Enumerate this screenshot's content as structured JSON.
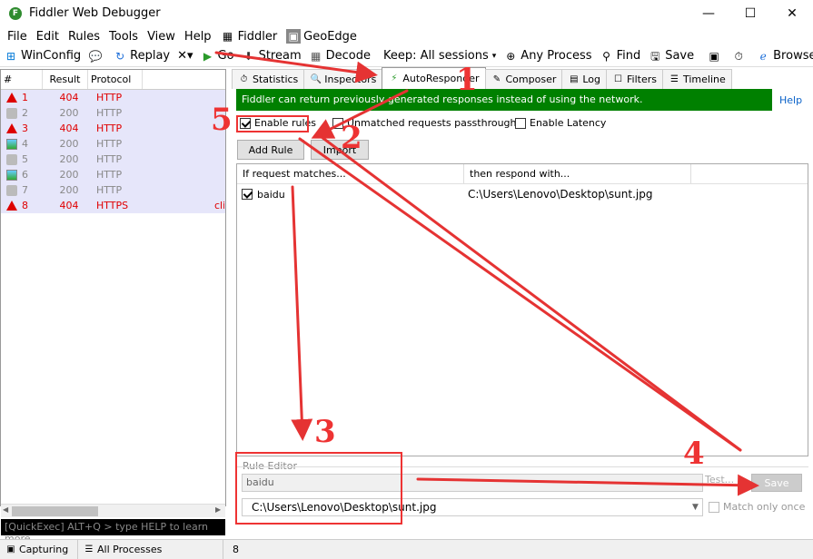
{
  "window": {
    "title": "Fiddler Web Debugger",
    "icon_letter": "F",
    "minimize_glyph": "—",
    "maximize_glyph": "☐",
    "close_glyph": "✕"
  },
  "menu": {
    "file": "File",
    "edit": "Edit",
    "rules": "Rules",
    "tools": "Tools",
    "view": "View",
    "help": "Help",
    "fiddler": "Fiddler",
    "geoedge": "GeoEdge"
  },
  "toolbar": {
    "winconfig": "WinConfig",
    "replay": "Replay",
    "remove": "✕▾",
    "go": "Go",
    "stream": "Stream",
    "decode": "Decode",
    "keep": "Keep: All sessions",
    "keep_dd": "▾",
    "any_process": "Any Process",
    "find": "Find",
    "save": "Save",
    "browse": "Browse",
    "browse_dd": "▾"
  },
  "sessions": {
    "headers": [
      "#",
      "Result",
      "Protocol"
    ],
    "rows": [
      {
        "num": "1",
        "result": "404",
        "protocol": "HTTP",
        "host": "",
        "icon": "warning-icon",
        "error": true
      },
      {
        "num": "2",
        "result": "200",
        "protocol": "HTTP",
        "host": "",
        "icon": "lock-icon",
        "error": false
      },
      {
        "num": "3",
        "result": "404",
        "protocol": "HTTP",
        "host": "",
        "icon": "warning-icon",
        "error": true
      },
      {
        "num": "4",
        "result": "200",
        "protocol": "HTTP",
        "host": "",
        "icon": "image-icon",
        "error": false
      },
      {
        "num": "5",
        "result": "200",
        "protocol": "HTTP",
        "host": "",
        "icon": "lock-icon",
        "error": false
      },
      {
        "num": "6",
        "result": "200",
        "protocol": "HTTP",
        "host": "",
        "icon": "image-icon",
        "error": false
      },
      {
        "num": "7",
        "result": "200",
        "protocol": "HTTP",
        "host": "",
        "icon": "lock-icon",
        "error": false
      },
      {
        "num": "8",
        "result": "404",
        "protocol": "HTTPS",
        "host": "clie",
        "icon": "warning-icon",
        "error": true
      }
    ]
  },
  "quickexec": "[QuickExec] ALT+Q > type HELP to learn more",
  "status": {
    "capturing": "Capturing",
    "processes": "All Processes",
    "count": "8"
  },
  "tabs": [
    {
      "label": "Statistics",
      "icon": "⏱"
    },
    {
      "label": "Inspectors",
      "icon": "🔍"
    },
    {
      "label": "AutoResponder",
      "icon": "⚡",
      "active": true
    },
    {
      "label": "Composer",
      "icon": "✎"
    },
    {
      "label": "Log",
      "icon": "▤"
    },
    {
      "label": "Filters",
      "icon": "☐"
    },
    {
      "label": "Timeline",
      "icon": "☰"
    }
  ],
  "autoresponder": {
    "banner": "Fiddler can return previously generated responses instead of using the network.",
    "help": "Help",
    "enable_rules": "Enable rules",
    "unmatched_passthrough": "Unmatched requests passthrough",
    "enable_latency": "Enable Latency",
    "add_rule": "Add Rule",
    "import": "Import",
    "col_match": "If request matches...",
    "col_respond": "then respond with...",
    "rule_match": "baidu",
    "rule_response": "C:\\Users\\Lenovo\\Desktop\\sunt.jpg"
  },
  "rule_editor": {
    "label": "Rule Editor",
    "match_value": "baidu",
    "response_value": "C:\\Users\\Lenovo\\Desktop\\sunt.jpg",
    "test": "Test...",
    "save": "Save",
    "match_only_once": "Match only once"
  },
  "annotations": {
    "n1": "1",
    "n2": "2",
    "n3": "3",
    "n4": "4",
    "n5": "5",
    "color": "#e53333"
  }
}
